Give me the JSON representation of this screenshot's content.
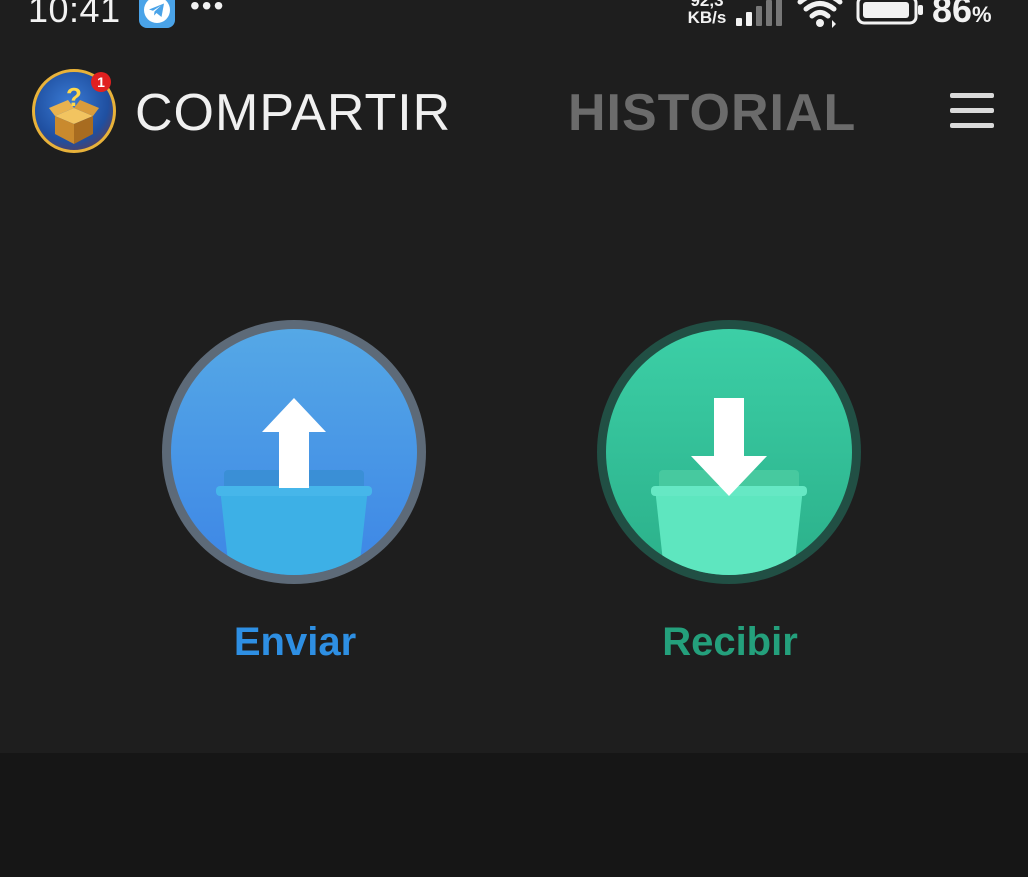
{
  "status_bar": {
    "time": "10:41",
    "notification_icons": [
      "telegram-icon",
      "more-dots-icon"
    ],
    "more_dots": "•••",
    "network_speed_value": "92,3",
    "network_speed_unit": "KB/s",
    "battery_percent": "86",
    "battery_percent_sign": "%"
  },
  "app_bar": {
    "avatar_badge_count": "1",
    "tabs": [
      {
        "label": "COMPARTIR",
        "active": true
      },
      {
        "label": "HISTORIAL",
        "active": false
      }
    ]
  },
  "actions": {
    "send": {
      "label": "Enviar",
      "color": "#2e8fe3",
      "icon": "upload-folder-icon"
    },
    "receive": {
      "label": "Recibir",
      "color": "#24a07c",
      "icon": "download-folder-icon"
    }
  },
  "colors": {
    "background": "#1e1e1e",
    "bottom_panel": "#161616",
    "tab_inactive": "#6b6b6b"
  }
}
